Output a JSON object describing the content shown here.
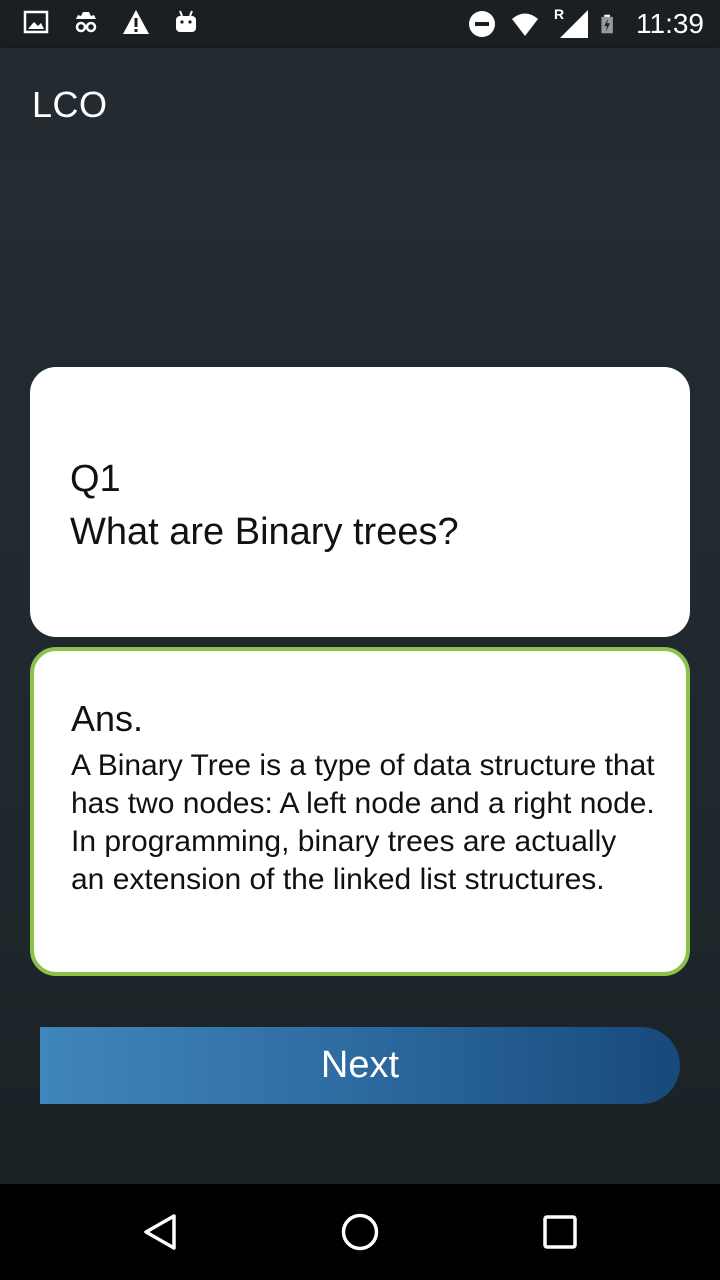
{
  "status_bar": {
    "time": "11:39",
    "left_icons": [
      "image-icon",
      "incognito-icon",
      "warning-icon",
      "android-icon"
    ],
    "right_icons": [
      "do-not-disturb-icon",
      "wifi-icon",
      "signal-icon",
      "battery-icon"
    ],
    "signal_roaming_label": "R"
  },
  "app_bar": {
    "title": "LCO"
  },
  "question_card": {
    "number": "Q1",
    "text": "What are Binary trees?"
  },
  "answer_card": {
    "label": "Ans.",
    "text": "A Binary Tree is a type of data structure that has two nodes: A left node and a right node. In programming, binary trees are actually an extension of the linked list structures."
  },
  "next_button": {
    "label": "Next"
  },
  "nav_bar": {
    "icons": [
      "back-icon",
      "home-icon",
      "recents-icon"
    ]
  },
  "colors": {
    "answer_border": "#8bc34a",
    "button_start": "#3f86bd",
    "button_end": "#17497a",
    "app_bar": "#232b31"
  }
}
